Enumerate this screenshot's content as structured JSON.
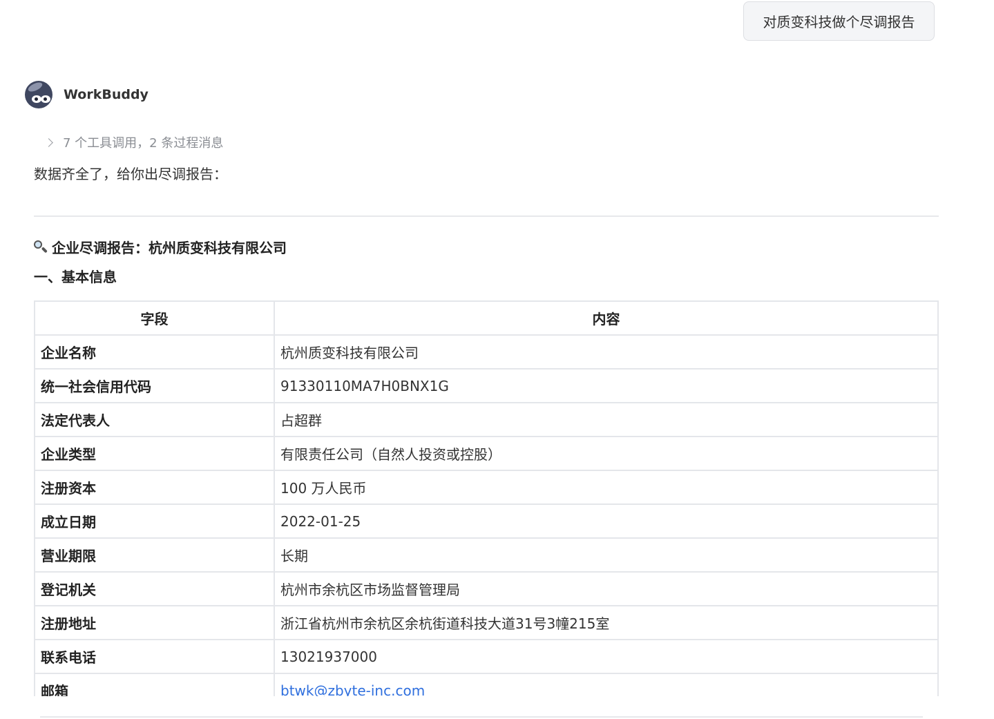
{
  "user_message": "对质变科技做个尽调报告",
  "assistant": {
    "name": "WorkBuddy",
    "tool_summary": "7 个工具调用，2 条过程消息",
    "intro": "数据齐全了，给你出尽调报告："
  },
  "report": {
    "title": "企业尽调报告：杭州质变科技有限公司",
    "title_icon": "magnifier-icon",
    "section1_title": "一、基本信息",
    "table": {
      "headers": [
        "字段",
        "内容"
      ],
      "rows": [
        [
          "企业名称",
          "杭州质变科技有限公司"
        ],
        [
          "统一社会信用代码",
          "91330110MA7H0BNX1G"
        ],
        [
          "法定代表人",
          "占超群"
        ],
        [
          "企业类型",
          "有限责任公司（自然人投资或控股）"
        ],
        [
          "注册资本",
          "100 万人民币"
        ],
        [
          "成立日期",
          "2022-01-25"
        ],
        [
          "营业期限",
          "长期"
        ],
        [
          "登记机关",
          "杭州市余杭区市场监督管理局"
        ],
        [
          "注册地址",
          "浙江省杭州市余杭区余杭街道科技大道31号3幢215室"
        ],
        [
          "联系电话",
          "13021937000"
        ],
        [
          "邮箱",
          "btwk@zbyte-inc.com"
        ]
      ]
    }
  },
  "colors": {
    "link": "#2f6fde",
    "border": "#e4e6ea",
    "bubble_bg": "#f4f5f7"
  }
}
